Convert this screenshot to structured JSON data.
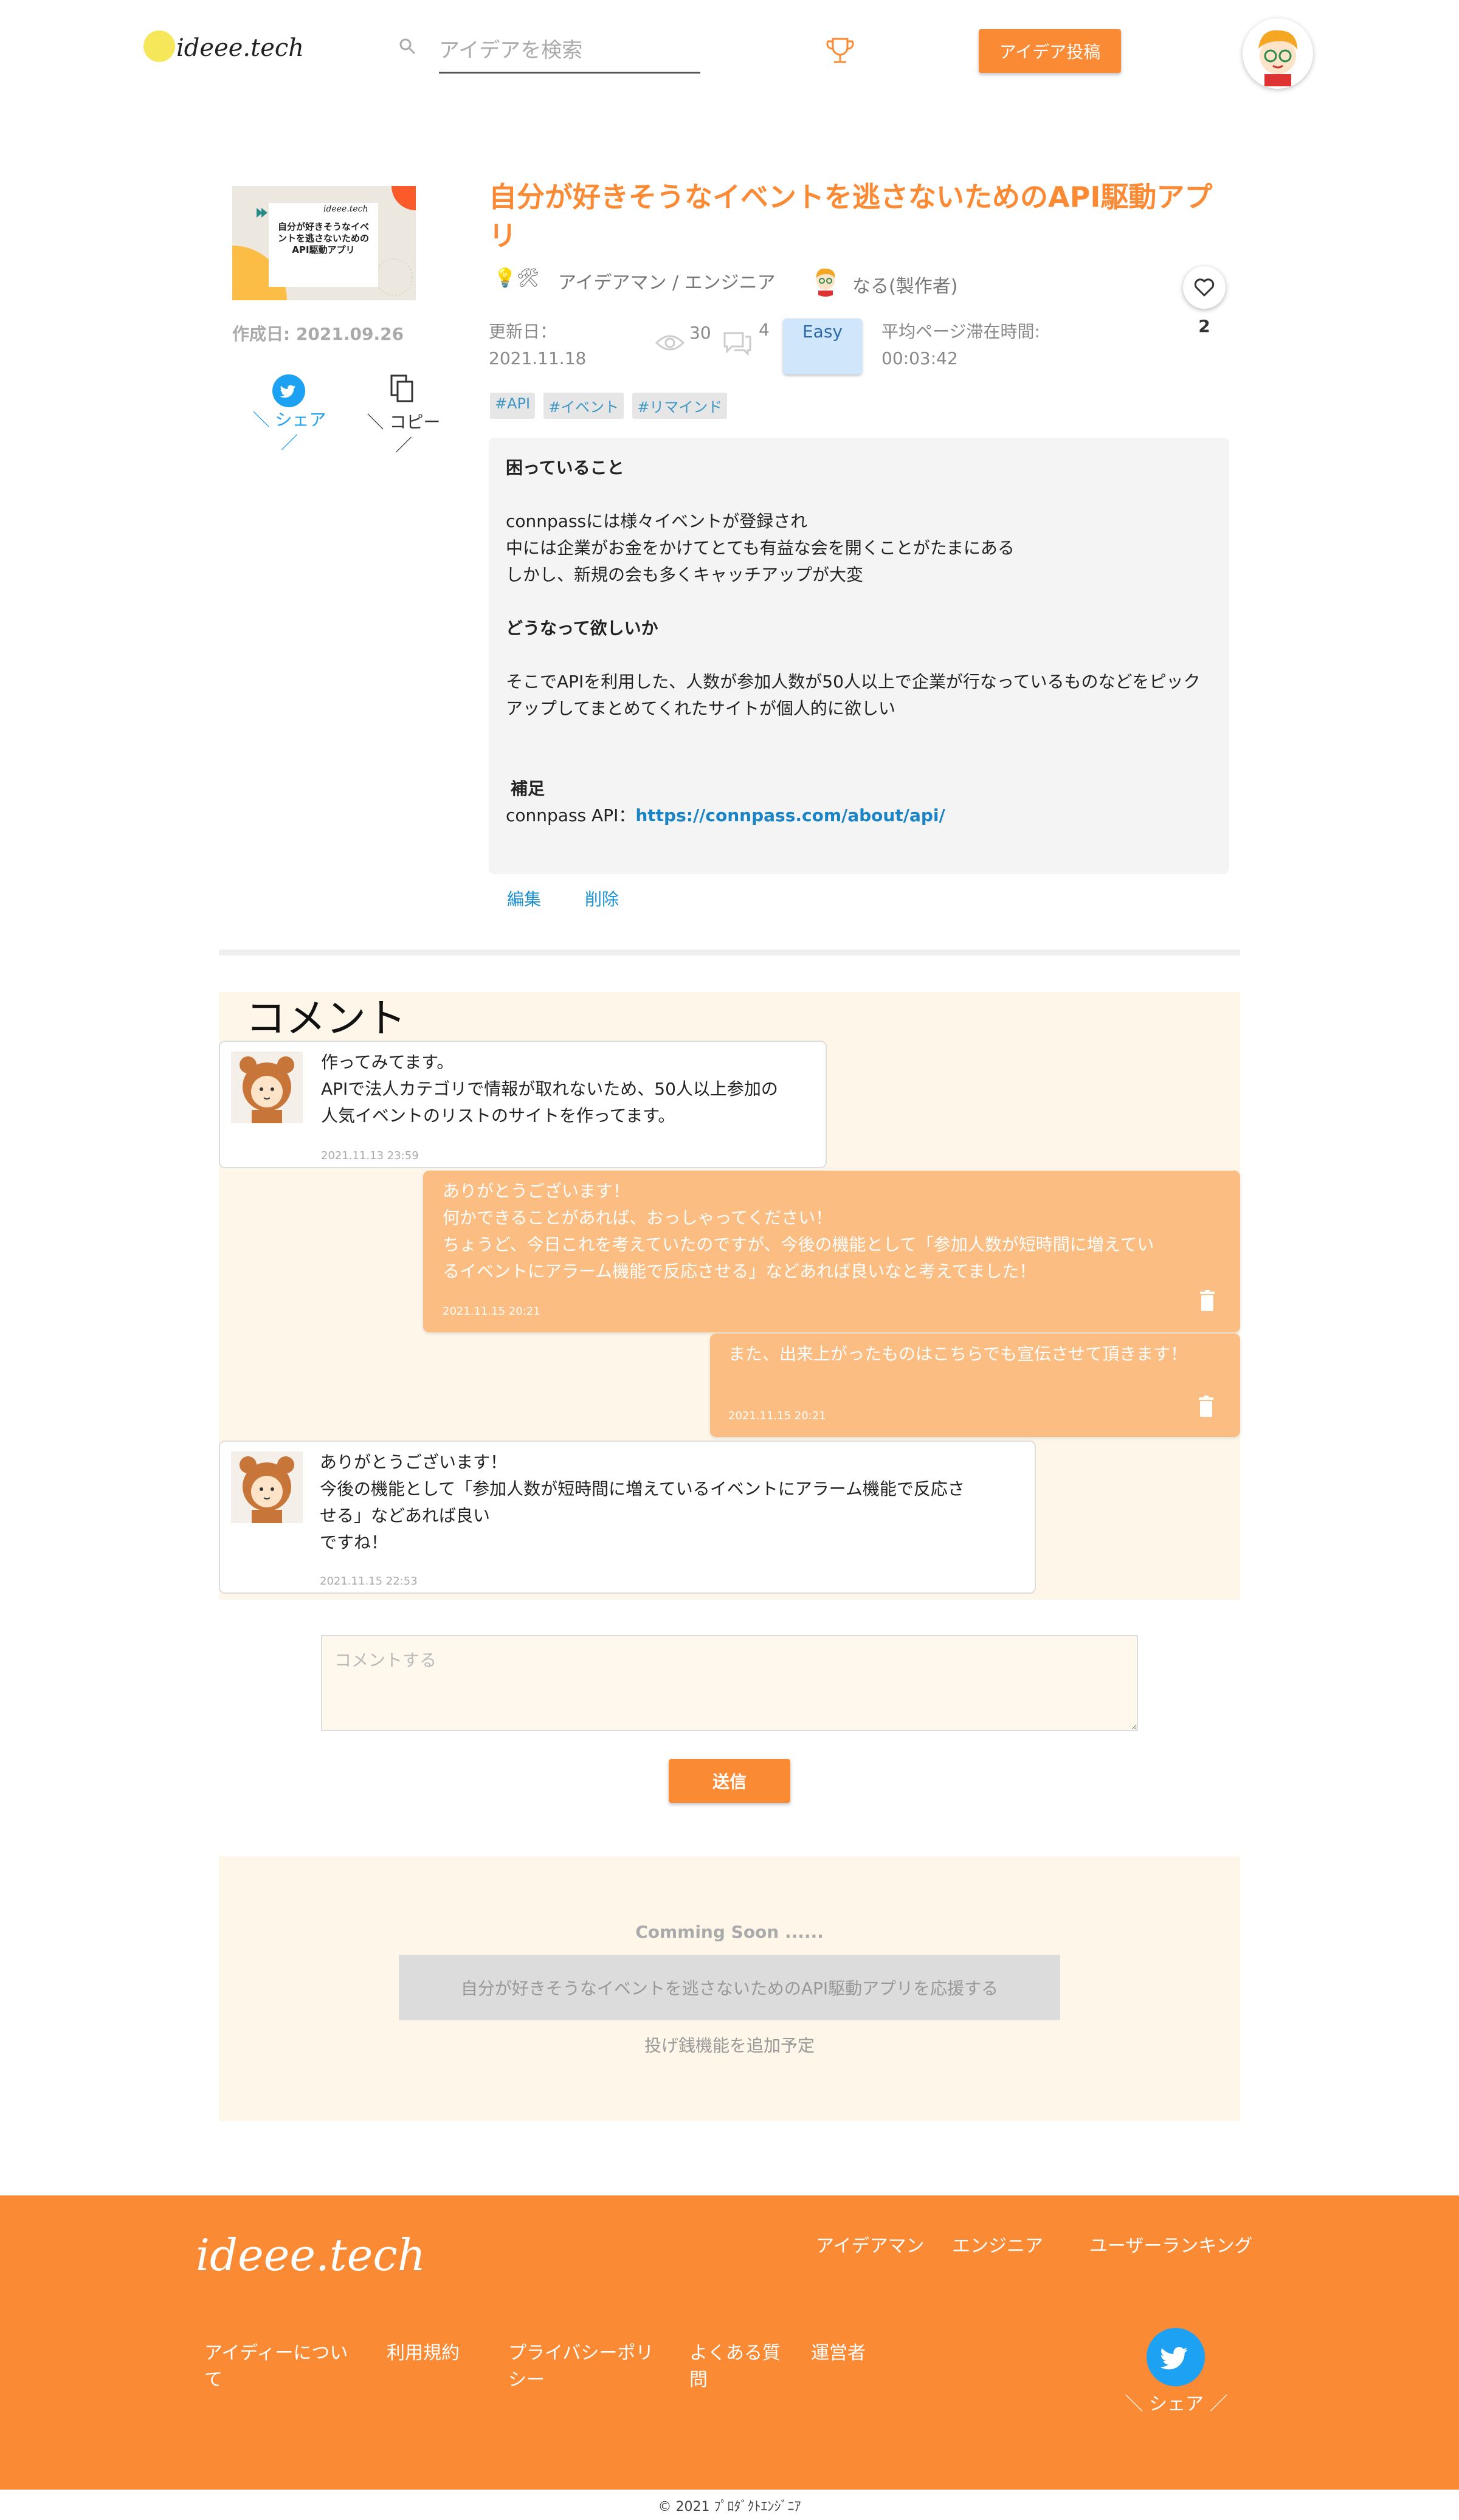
{
  "header": {
    "logo_text": "ideee.tech",
    "search_placeholder": "アイデアを検索",
    "post_button": "アイデア投稿"
  },
  "idea": {
    "thumbnail_logo": "ideee.tech",
    "thumbnail_title": "自分が好きそうなイベントを逃さないためのAPI駆動アプリ",
    "created": "作成日: 2021.09.26",
    "share_label": "＼ シェア ／",
    "copy_label": "＼ コピー ／",
    "title": "自分が好きそうなイベントを逃さないためのAPI駆動アプリ",
    "category_icons": "💡🛠",
    "category": "アイデアマン / エンジニア",
    "author": "なる(製作者)",
    "like_count": "2",
    "updated": "更新日：2021.11.18",
    "views": "30",
    "comments_count": "4",
    "difficulty": "Easy",
    "avg_time": "平均ページ滞在時間: 00:03:42",
    "tags": [
      "#API",
      "#イベント",
      "#リマインド"
    ],
    "description": {
      "h1": "困っていること",
      "p1": [
        "connpassには様々イベントが登録され",
        "中には企業がお金をかけてとても有益な会を開くことがたまにある",
        "しかし、新規の会も多くキャッチアップが大変"
      ],
      "h2": "どうなって欲しいか",
      "p2": [
        "そこでAPIを利用した、人数が参加人数が50人以上で企業が行なっているものなどをピックアップしてまとめてくれたサイトが個人的に欲しい"
      ],
      "h3": "補足",
      "p3_prefix": "connpass API：",
      "p3_link": "https://connpass.com/about/api/"
    },
    "edit": "編集",
    "delete": "削除"
  },
  "comments": {
    "title": "コメント",
    "items": [
      {
        "side": "left",
        "text": [
          "作ってみてます。",
          "APIで法人カテゴリで情報が取れないため、50人以上参加の",
          "人気イベントのリストのサイトを作ってます。"
        ],
        "date": "2021.11.13 23:59"
      },
      {
        "side": "right",
        "text": [
          "ありがとうございます！",
          "何かできることがあれば、おっしゃってください！",
          "ちょうど、今日これを考えていたのですが、今後の機能として「参加人数が短時間に増えてい",
          "るイベントにアラーム機能で反応させる」などあれば良いなと考えてました！"
        ],
        "date": "2021.11.15 20:21"
      },
      {
        "side": "right",
        "text": [
          "また、出来上がったものはこちらでも宣伝させて頂きます！"
        ],
        "date": "2021.11.15 20:21"
      },
      {
        "side": "left",
        "text": [
          "ありがとうございます！",
          "今後の機能として「参加人数が短時間に増えているイベントにアラーム機能で反応さ",
          "せる」などあれば良い",
          "ですね！"
        ],
        "date": "2021.11.15 22:53"
      }
    ],
    "input_placeholder": "コメントする",
    "send": "送信"
  },
  "support": {
    "coming_soon": "Comming Soon ......",
    "button": "自分が好きそうなイベントを逃さないためのAPI駆動アプリを応援する",
    "note": "投げ銭機能を追加予定"
  },
  "footer": {
    "logo_text": "ideee.tech",
    "nav": [
      "アイデアマン",
      "エンジニア",
      "ユーザーランキング"
    ],
    "links": [
      "アイディーについて",
      "利用規約",
      "プライバシーポリシー",
      "よくある質問",
      "運営者"
    ],
    "share": "＼ シェア ／",
    "copyright": "© 2021 ﾌﾟﾛﾀﾞｸﾄｴﾝｼﾞﾆｱ"
  },
  "colors": {
    "accent": "#fb8a35",
    "twitter": "#1da1f2",
    "link": "#1a84c6",
    "comment_bg": "#fff6ea",
    "reply_bubble": "#fbbd82"
  }
}
